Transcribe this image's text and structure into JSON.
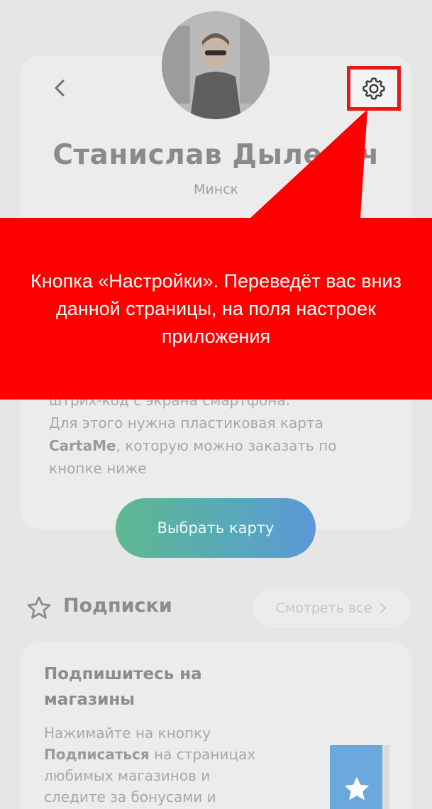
{
  "profile": {
    "name": "Станислав Дылевич",
    "city": "Минск"
  },
  "header": {
    "back_icon": "chevron-left-icon",
    "settings_icon": "gear-icon"
  },
  "callout": {
    "text": "Кнопка «Настройки». Переведёт вас вниз данной страницы, на поля настроек приложения",
    "color": "#ff0000"
  },
  "card": {
    "desc_line1": "штрих-код с экрана смартфона.",
    "desc_line2": "Для этого нужна пластиковая карта",
    "desc_brand": "CartaMe",
    "desc_line3_rest": ", которую можно заказать по",
    "desc_line4": "кнопке ниже",
    "button_label": "Выбрать карту"
  },
  "subscriptions": {
    "title": "Подписки",
    "see_all_label": "Смотреть все",
    "card_title": "Подпишитесь на магазины",
    "text_part1": "Нажимайте на кнопку",
    "text_bold": "Подписаться",
    "text_part2": " на страницах",
    "text_line3": "любимых магазинов и",
    "text_line4": "следите за бонусами и"
  },
  "colors": {
    "accent_gradient_start": "#5fb890",
    "accent_gradient_end": "#5d98d8",
    "highlight_border": "#e41a1a"
  }
}
